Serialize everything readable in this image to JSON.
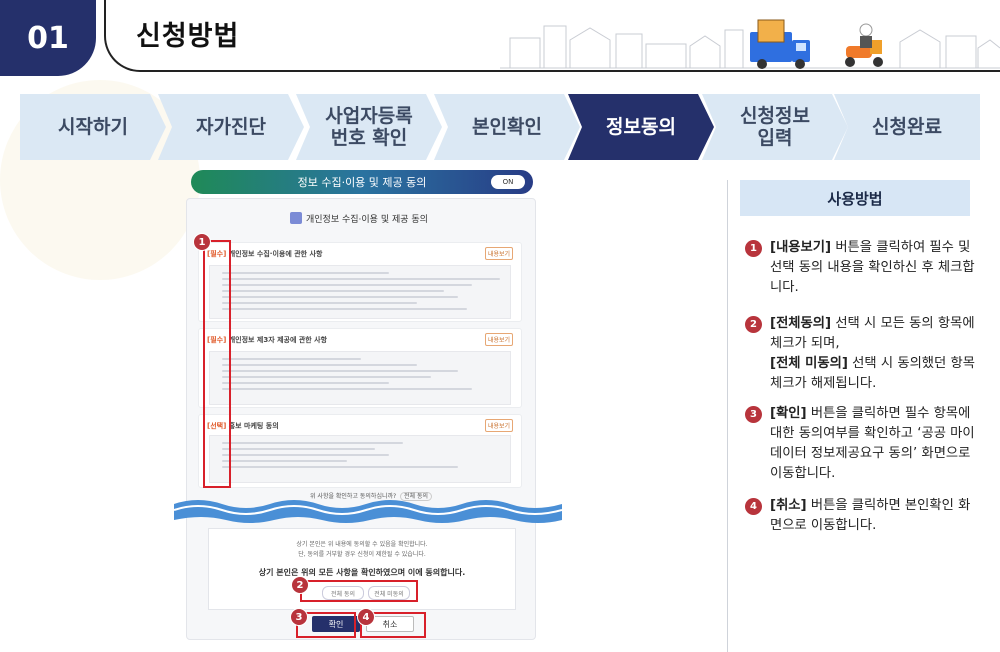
{
  "header": {
    "number": "01",
    "title": "신청방법"
  },
  "steps": [
    {
      "label": "시작하기",
      "active": false
    },
    {
      "label": "자가진단",
      "active": false
    },
    {
      "label": "사업자등록\n번호 확인",
      "active": false
    },
    {
      "label": "본인확인",
      "active": false
    },
    {
      "label": "정보동의",
      "active": true
    },
    {
      "label": "신청정보\n입력",
      "active": false
    },
    {
      "label": "신청완료",
      "active": false
    }
  ],
  "colors": {
    "navy": "#25306b",
    "step_light": "#dbe8f4",
    "red": "#d8202a",
    "badge": "#b8343c",
    "help_header": "#d7e6f5"
  },
  "screen": {
    "topbar_title": "정보 수집·이용 및 제공 동의",
    "toggle": "ON",
    "inner_title": "개인정보 수집·이용 및 제공 동의",
    "sections": [
      {
        "prefix": "[필수]",
        "title": "개인정보 수집·이용에 관한 사항",
        "button": "내용보기"
      },
      {
        "prefix": "[필수]",
        "title": "개인정보 제3자 제공에 관한 사항",
        "button": "내용보기"
      },
      {
        "prefix": "[선택]",
        "title": "홍보 마케팅 동의",
        "button": "내용보기"
      }
    ],
    "agree_question": "위 사항을 확인하고 동의하십니까?",
    "agree_option": "전체 동의",
    "notice_line1": "상기 본인은 위 내용에 동의할 수 있음을 확인합니다.",
    "notice_line2": "단, 동의를 거부할 경우 신청이 제한될 수 있습니다.",
    "final_question": "상기 본인은 위의 모든 사항을 확인하였으며 이에 동의합니다.",
    "agree_all": "전체 동의",
    "disagree_all": "전체 미동의",
    "ok_button": "확인",
    "cancel_button": "취소",
    "badges": [
      "1",
      "2",
      "3",
      "4"
    ]
  },
  "help": {
    "title": "사용방법",
    "items": [
      {
        "num": "1",
        "bold": "[내용보기]",
        "rest": " 버튼을 클릭하여 필수 및 선택 동의 내용을 확인하신 후 체크합니다."
      },
      {
        "num": "2",
        "bold": "[전체동의]",
        "rest": " 선택 시 모든 동의 항목에 체크가 되며,",
        "bold2": "[전체 미동의]",
        "rest2": " 선택 시 동의했던 항목 체크가 해제됩니다."
      },
      {
        "num": "3",
        "bold": "[확인]",
        "rest": " 버튼을 클릭하면 필수 항목에 대한 동의여부를 확인하고 ‘공공 마이데이터 정보제공요구 동의’ 화면으로 이동합니다."
      },
      {
        "num": "4",
        "bold": "[취소]",
        "rest": " 버튼을 클릭하면 본인확인 화면으로 이동합니다."
      }
    ]
  }
}
